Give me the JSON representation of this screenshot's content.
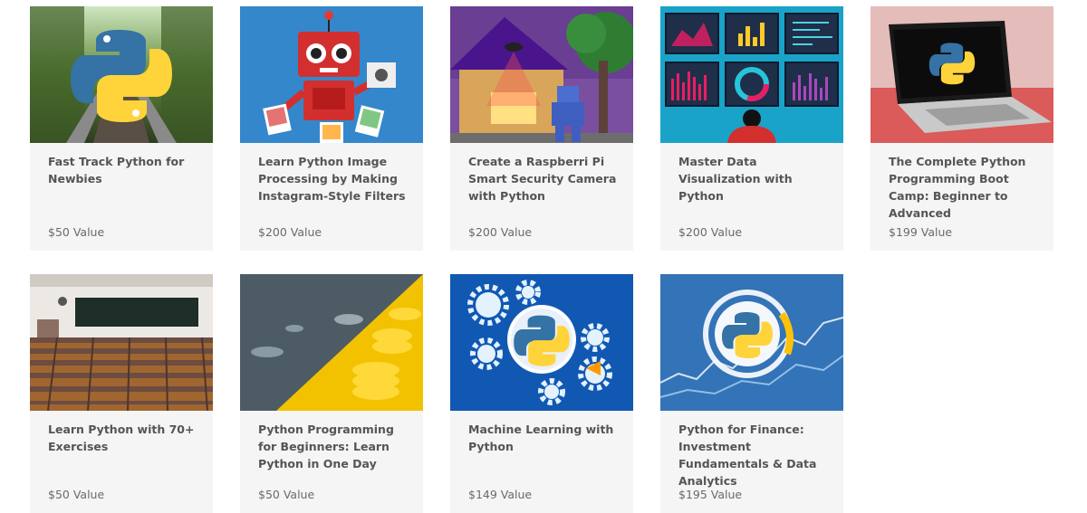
{
  "courses": [
    {
      "title": "Fast Track Python for Newbies",
      "price": "$50 Value",
      "image_icon": "python-logo-on-railway-track"
    },
    {
      "title": "Learn Python Image Processing by Making Instagram-Style Filters",
      "price": "$200 Value",
      "image_icon": "red-robot-with-photos"
    },
    {
      "title": "Create a Raspberri Pi Smart Security Camera with Python",
      "price": "$200 Value",
      "image_icon": "house-with-robot-and-drone"
    },
    {
      "title": "Master Data Visualization with Python",
      "price": "$200 Value",
      "image_icon": "dashboard-screens"
    },
    {
      "title": "The Complete Python Programming Boot Camp: Beginner to Advanced",
      "price": "$199 Value",
      "image_icon": "laptop-with-python-logo"
    },
    {
      "title": "Learn Python with 70+ Exercises",
      "price": "$50 Value",
      "image_icon": "lecture-hall"
    },
    {
      "title": "Python Programming for Beginners: Learn Python in One Day",
      "price": "$50 Value",
      "image_icon": "coins-stacks"
    },
    {
      "title": "Machine Learning with Python",
      "price": "$149 Value",
      "image_icon": "python-gears"
    },
    {
      "title": "Python for Finance: Investment Fundamentals & Data Analytics",
      "price": "$195 Value",
      "image_icon": "python-finance-chart"
    }
  ],
  "colors": {
    "card_bg": "#f5f5f5",
    "title_text": "#555555",
    "price_text": "#6a6a6a",
    "python_blue": "#3572a5",
    "python_yellow": "#ffd43b"
  }
}
